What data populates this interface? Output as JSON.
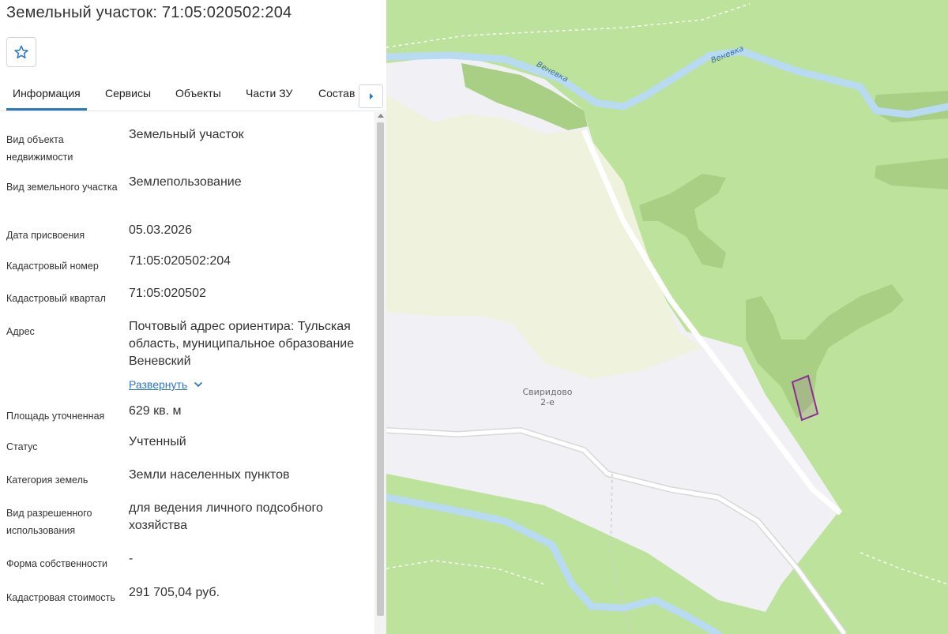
{
  "header": {
    "title": "Земельный участок: 71:05:020502:204"
  },
  "tabs": [
    {
      "label": "Информация"
    },
    {
      "label": "Сервисы"
    },
    {
      "label": "Объекты"
    },
    {
      "label": "Части ЗУ"
    },
    {
      "label": "Состав"
    }
  ],
  "info": {
    "rows": [
      {
        "label": "Вид объекта недвижимости",
        "value": "Земельный участок"
      },
      {
        "label": "Вид земельного участка",
        "value": "Землепользование"
      },
      {
        "label": "Дата присвоения",
        "value": "05.03.2026"
      },
      {
        "label": "Кадастровый номер",
        "value": "71:05:020502:204"
      },
      {
        "label": "Кадастровый квартал",
        "value": "71:05:020502"
      },
      {
        "label": "Адрес",
        "value": "Почтовый адрес ориентира: Тульская область, муниципальное образование Веневский"
      },
      {
        "label": "Площадь уточненная",
        "value": "629 кв. м"
      },
      {
        "label": "Статус",
        "value": "Учтенный"
      },
      {
        "label": "Категория земель",
        "value": "Земли населенных пунктов"
      },
      {
        "label": "Вид разрешенного использования",
        "value": "для ведения личного подсобного хозяйства"
      },
      {
        "label": "Форма собственности",
        "value": "-"
      },
      {
        "label": "Кадастровая стоимость",
        "value": "291 705,04 руб."
      }
    ],
    "expand_label": "Развернуть"
  },
  "map": {
    "locality_line1": "Свиридово",
    "locality_line2": "2-е",
    "river_name": "Веневка",
    "colors": {
      "forest": "#bde29b",
      "dense_forest": "#a9cf85",
      "settlement": "#f1f1f5",
      "field": "#eff2dd",
      "river": "#b8daf3",
      "road": "#ffffff",
      "parcel_border": "#8e2a9a"
    }
  },
  "icons": {
    "favorite": "star-icon",
    "tabs_next": "caret-right-icon",
    "expand": "chevron-down-icon"
  }
}
